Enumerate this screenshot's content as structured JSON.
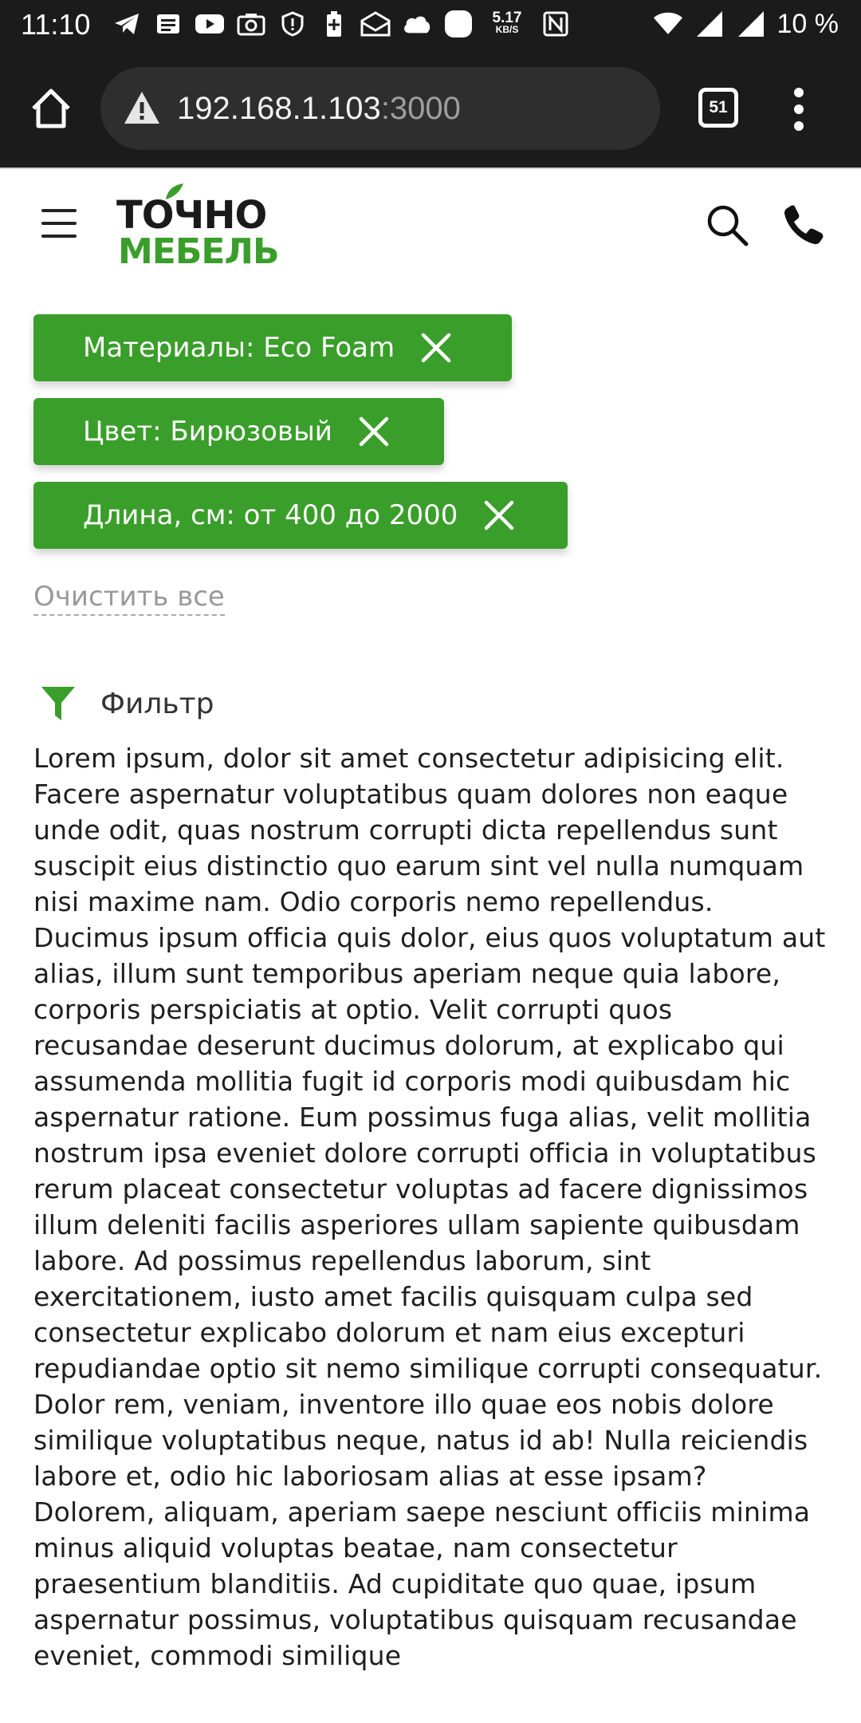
{
  "status_bar": {
    "time": "11:10",
    "speed_value": "5.17",
    "speed_unit": "KB/S",
    "battery": "10 %"
  },
  "browser": {
    "url_host": "192.168.1.103",
    "url_port": ":3000",
    "tab_count": "51"
  },
  "header": {
    "logo_top": "ТОЧНО",
    "logo_bottom": "МЕБЕЛЬ",
    "brand_color": "#3a9e2a"
  },
  "filters": {
    "chips": [
      {
        "label": "Материалы: Eco Foam"
      },
      {
        "label": "Цвет: Бирюзовый"
      },
      {
        "label": "Длина, см: от 400 до 2000"
      }
    ],
    "clear_all": "Очистить все",
    "filter_label": "Фильтр"
  },
  "content": {
    "text": "Lorem ipsum, dolor sit amet consectetur adipisicing elit. Facere aspernatur voluptatibus quam dolores non eaque unde odit, quas nostrum corrupti dicta repellendus sunt suscipit eius distinctio quo earum sint vel nulla numquam nisi maxime nam. Odio corporis nemo repellendus. Ducimus ipsum officia quis dolor, eius quos voluptatum aut alias, illum sunt temporibus aperiam neque quia labore, corporis perspiciatis at optio. Velit corrupti quos recusandae deserunt ducimus dolorum, at explicabo qui assumenda mollitia fugit id corporis modi quibusdam hic aspernatur ratione. Eum possimus fuga alias, velit mollitia nostrum ipsa eveniet dolore corrupti officia in voluptatibus rerum placeat consectetur voluptas ad facere dignissimos illum deleniti facilis asperiores ullam sapiente quibusdam labore. Ad possimus repellendus laborum, sint exercitationem, iusto amet facilis quisquam culpa sed consectetur explicabo dolorum et nam eius excepturi repudiandae optio sit nemo similique corrupti consequatur. Dolor rem, veniam, inventore illo quae eos nobis dolore similique voluptatibus neque, natus id ab! Nulla reiciendis labore et, odio hic laboriosam alias at esse ipsam? Dolorem, aliquam, aperiam saepe nesciunt officiis minima minus aliquid voluptas beatae, nam consectetur praesentium blanditiis. Ad cupiditate quo quae, ipsum aspernatur possimus, voluptatibus quisquam recusandae eveniet, commodi similique"
  },
  "icons": [
    "telegram-icon",
    "news-icon",
    "youtube-icon",
    "camera-icon",
    "shield-icon",
    "battery-saver-icon",
    "mail-icon",
    "cloud-icon",
    "notification-icon",
    "nfc-icon",
    "wifi-icon",
    "signal-icon",
    "home-icon",
    "warning-icon",
    "tabs-icon",
    "more-vert-icon",
    "hamburger-icon",
    "search-icon",
    "phone-icon",
    "close-icon",
    "filter-icon"
  ]
}
